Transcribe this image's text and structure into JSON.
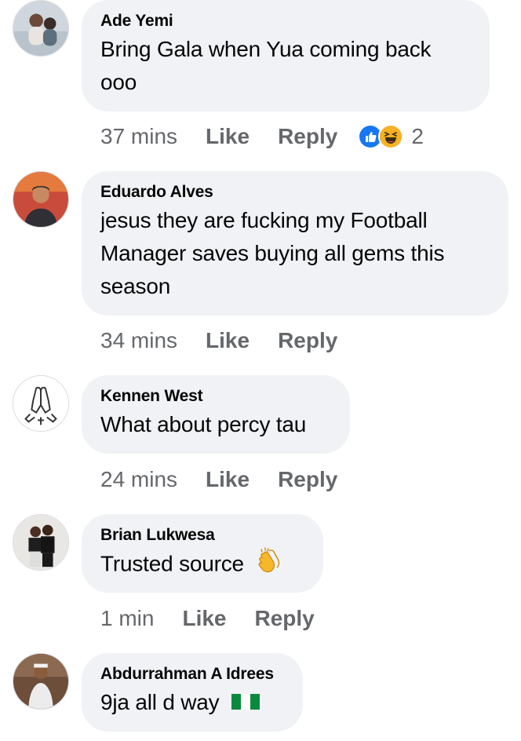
{
  "comments": [
    {
      "author": "Ade Yemi",
      "text_lines": [
        "Bring Gala when Yua coming back",
        "ooo"
      ],
      "time": "37 mins",
      "like_label": "Like",
      "reply_label": "Reply",
      "reactions": [
        "like-reaction-icon",
        "haha-reaction-icon"
      ],
      "reaction_count": "2"
    },
    {
      "author": "Eduardo Alves",
      "text_lines": [
        "jesus they are fucking my Football",
        "Manager saves buying all gems this",
        "season"
      ],
      "time": "34 mins",
      "like_label": "Like",
      "reply_label": "Reply"
    },
    {
      "author": "Kennen West",
      "text_lines": [
        "What about percy tau"
      ],
      "time": "24 mins",
      "like_label": "Like",
      "reply_label": "Reply"
    },
    {
      "author": "Brian Lukwesa",
      "text_lines": [
        "Trusted source"
      ],
      "emoji": "clapping-hands-emoji",
      "time": "1 min",
      "like_label": "Like",
      "reply_label": "Reply"
    },
    {
      "author": "Abdurrahman A Idrees",
      "text_lines": [
        "9ja all d way"
      ],
      "emoji": "nigeria-flag-emoji"
    }
  ],
  "colors": {
    "bubble": "#f0f2f5",
    "meta_text": "#65676b",
    "primary_text": "#050505",
    "like_blue": "#1877f2",
    "haha_yellow": "#f7b125"
  }
}
